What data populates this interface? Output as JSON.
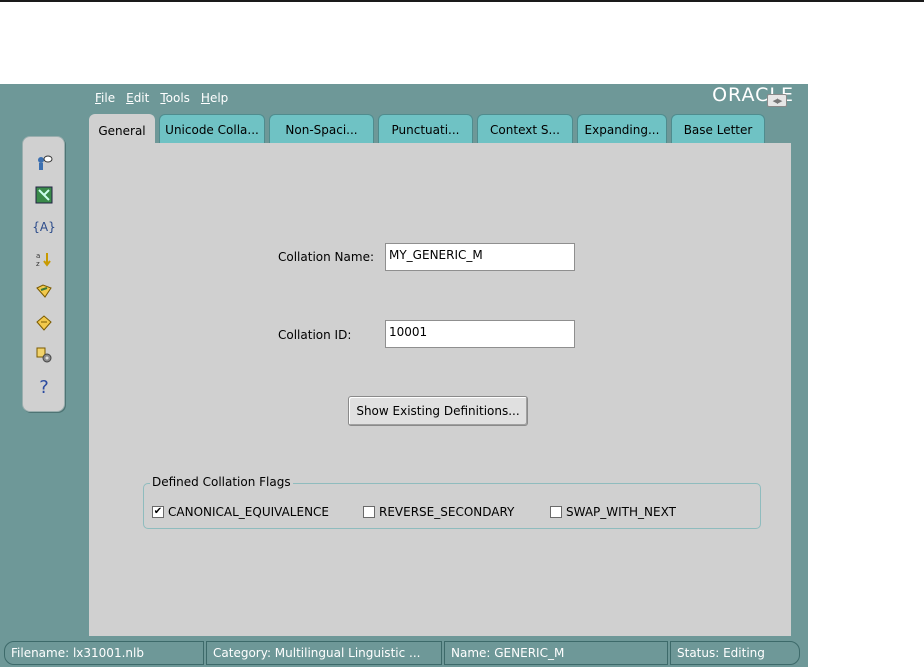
{
  "menu": {
    "items": [
      {
        "mnemonic": "F",
        "rest": "ile"
      },
      {
        "mnemonic": "E",
        "rest": "dit"
      },
      {
        "mnemonic": "T",
        "rest": "ools"
      },
      {
        "mnemonic": "H",
        "rest": "elp"
      }
    ],
    "logo": "ORACLE"
  },
  "tabs": [
    {
      "label": "General",
      "active": true
    },
    {
      "label": "Unicode Colla...",
      "active": false
    },
    {
      "label": "Non-Spaci...",
      "active": false
    },
    {
      "label": "Punctuati...",
      "active": false
    },
    {
      "label": "Context S...",
      "active": false
    },
    {
      "label": "Expanding...",
      "active": false
    },
    {
      "label": "Base Letter",
      "active": false
    }
  ],
  "toolbar": {
    "icons": [
      "wizard-icon",
      "tree-icon",
      "braces-icon",
      "sort-icon",
      "open-icon",
      "save-icon",
      "generate-icon",
      "help-icon"
    ],
    "braces_label": "{A}",
    "help_label": "?"
  },
  "form": {
    "collation_name_label": "Collation Name:",
    "collation_name_value": "MY_GENERIC_M",
    "collation_id_label": "Collation ID:",
    "collation_id_value": "10001",
    "show_definitions_button": "Show Existing Definitions..."
  },
  "flags": {
    "legend": "Defined Collation Flags",
    "items": [
      {
        "label": "CANONICAL_EQUIVALENCE",
        "checked": true
      },
      {
        "label": "REVERSE_SECONDARY",
        "checked": false
      },
      {
        "label": "SWAP_WITH_NEXT",
        "checked": false
      }
    ]
  },
  "status": {
    "filename": "Filename: lx31001.nlb",
    "category": "Category: Multilingual Linguistic ...",
    "name": "Name: GENERIC_M",
    "state": "Status: Editing"
  },
  "colors": {
    "frame": "#6e9898",
    "panel": "#d0d0d0",
    "tab": "#6fc2c4"
  }
}
